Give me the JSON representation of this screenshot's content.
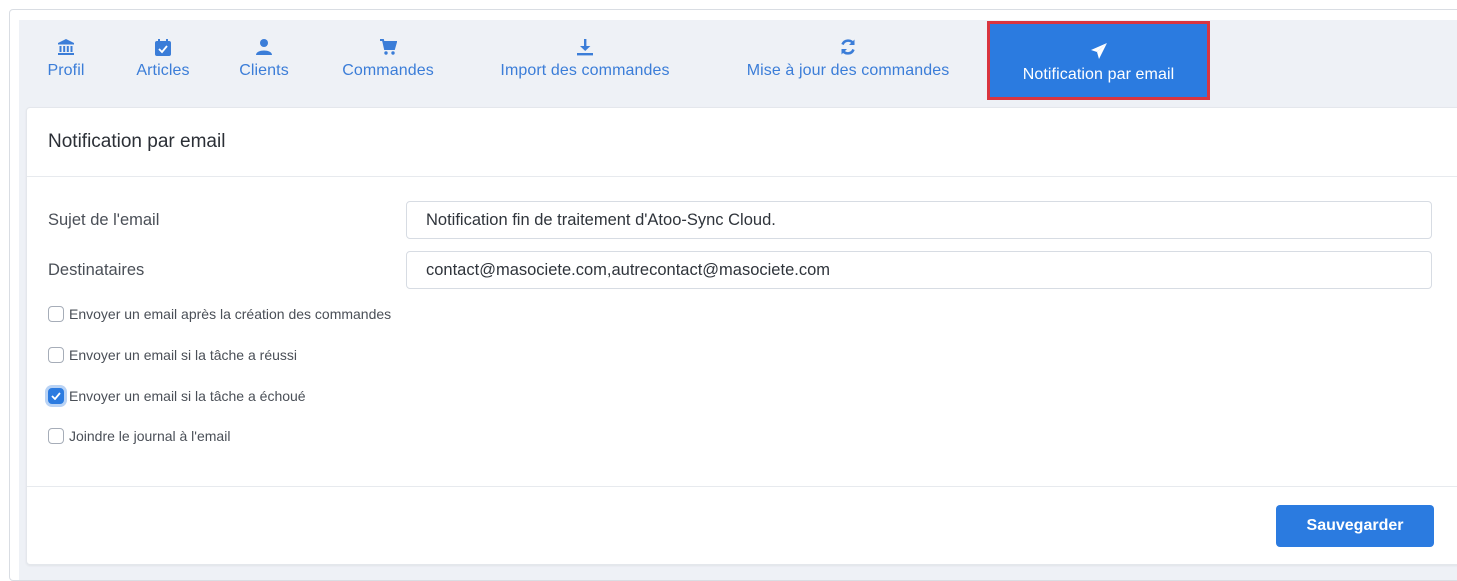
{
  "tabs": [
    {
      "label": "Profil",
      "icon": "bank-icon",
      "active": false
    },
    {
      "label": "Articles",
      "icon": "calendar-check-icon",
      "active": false
    },
    {
      "label": "Clients",
      "icon": "users-icon",
      "active": false
    },
    {
      "label": "Commandes",
      "icon": "cart-icon",
      "active": false
    },
    {
      "label": "Import des commandes",
      "icon": "download-icon",
      "active": false
    },
    {
      "label": "Mise à jour des commandes",
      "icon": "refresh-icon",
      "active": false
    },
    {
      "label": "Notification par email",
      "icon": "paper-plane-icon",
      "active": true
    }
  ],
  "card": {
    "title": "Notification par email",
    "subject_label": "Sujet de l'email",
    "subject_value": "Notification fin de traitement d'Atoo-Sync Cloud.",
    "recipients_label": "Destinataires",
    "recipients_value": "contact@masociete.com,autrecontact@masociete.com",
    "checkboxes": [
      {
        "label": "Envoyer un email après la création des commandes",
        "checked": false
      },
      {
        "label": "Envoyer un email si la tâche a réussi",
        "checked": false
      },
      {
        "label": "Envoyer un email si la tâche a échoué",
        "checked": true
      },
      {
        "label": "Joindre le journal à l'email",
        "checked": false
      }
    ],
    "save_label": "Sauvegarder"
  },
  "colors": {
    "accent": "#2b7be0",
    "tab_text": "#3b7dd8",
    "highlight_border": "#d9353f",
    "tabbar_bg": "#eef1f6"
  }
}
